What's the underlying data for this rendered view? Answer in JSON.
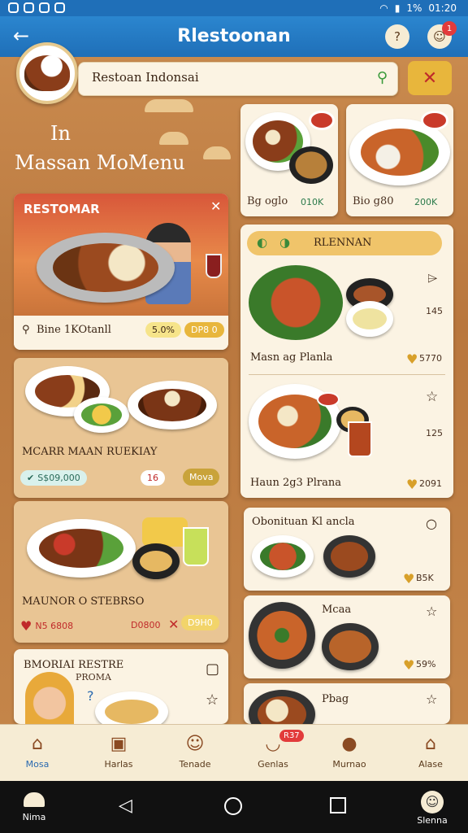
{
  "status": {
    "time": "01:20",
    "battery": "1%"
  },
  "appbar": {
    "title": "Rlestoonan",
    "help_glyph": "?",
    "notif_count": "1"
  },
  "search": {
    "value": "Restoan Indonsai"
  },
  "hero_text": {
    "line1": "In",
    "line2": "Massan MoMenu"
  },
  "featured": {
    "title": "RESTOMAR",
    "footer_label": "Bine 1KOtanll",
    "badge1": "5.0%",
    "badge2": "DP8 0"
  },
  "card_left2": {
    "title": "MCARR MAAN RUEKIAY",
    "price": "S$09,000",
    "count": "16",
    "action": "Mova"
  },
  "card_left3": {
    "title": "MAUNOR O STEBRSO",
    "price": "N5 6808",
    "price2": "D0800",
    "action": "D9H0"
  },
  "card_left4": {
    "title": "BMORIAI RESTRE",
    "subtitle": "PROMA"
  },
  "top_right": [
    {
      "label": "Bg oglo",
      "price": "010K"
    },
    {
      "label": "Bio g80",
      "price": "200K"
    }
  ],
  "right_panel": {
    "header": "RLENNAN",
    "items": [
      {
        "label": "Masn ag Planla",
        "price": "5770",
        "side": "145"
      },
      {
        "label": "Haun 2g3 Plrana",
        "price": "2091",
        "side": "125"
      }
    ]
  },
  "right_list": [
    {
      "title": "Obonituan Kl ancla",
      "price": "B5K"
    },
    {
      "title": "Mcaa",
      "price": "59%"
    },
    {
      "title": "Pbag",
      "price": ""
    }
  ],
  "bottom_nav": [
    {
      "label": "Mosa",
      "icon": "home-icon"
    },
    {
      "label": "Harlas",
      "icon": "bag-icon"
    },
    {
      "label": "Tenade",
      "icon": "profile-icon"
    },
    {
      "label": "Genlas",
      "icon": "bowl-icon",
      "badge": "R37"
    },
    {
      "label": "Murnao",
      "icon": "food-icon"
    },
    {
      "label": "Alase",
      "icon": "house-icon"
    }
  ],
  "sys_nav": {
    "left_label": "Nima",
    "right_label": "Slenna"
  },
  "colors": {
    "primary": "#1f6fb8",
    "accent": "#e2b340",
    "card": "#fbf3e3"
  }
}
